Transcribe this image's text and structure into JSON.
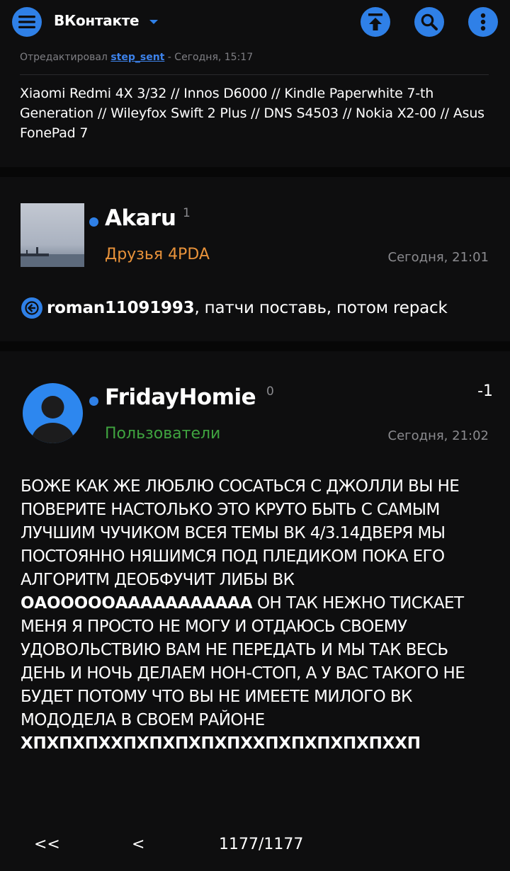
{
  "topbar": {
    "title": "ВКонтакте",
    "icons": [
      "menu-icon",
      "chevron-down-icon",
      "scroll-to-top-icon",
      "search-icon",
      "more-vertical-icon"
    ],
    "accent": "#2f80e7"
  },
  "edit_info": {
    "prefix": "Отредактировал",
    "user": "step_sent",
    "suffix": " - Сегодня, 15:17"
  },
  "signature": "Xiaomi Redmi 4X 3/32  //  Innos D6000  // Kindle Paperwhite 7-th Generation  //  Wileyfox Swift 2 Plus  //  DNS S4503  //  Nokia X2-00 //  Asus FonePad 7",
  "posts": [
    {
      "author": "Akaru",
      "reputation": "1",
      "group": "Друзья 4PDA",
      "group_color": "#e8923a",
      "time": "Сегодня, 21:01",
      "reply_to": "roman11091993",
      "text": ", патчи поставь, потом repack"
    },
    {
      "author": "FridayHomie",
      "reputation": "0",
      "group": "Пользователи",
      "group_color": "#3fa33f",
      "time": "Сегодня, 21:02",
      "rating": "-1",
      "text_part1": "БОЖЕ КАК ЖЕ ЛЮБЛЮ СОСАТЬСЯ С ДЖОЛЛИ ВЫ НЕ ПОВЕРИТЕ НАСТОЛЬКО ЭТО КРУТО БЫТЬ С САМЫМ ЛУЧШИМ ЧУЧИКОМ ВСЕЯ ТЕМЫ ВК 4/3.14ДВЕРЯ МЫ ПОСТОЯННО НЯШИМСЯ ПОД ПЛЕДИКОМ ПОКА ЕГО АЛГОРИТМ ДЕОБФУЧИТ ЛИБЫ ВК ",
      "text_bold1": "ОАОООООААААААААААА",
      "text_part2": " ОН ТАК НЕЖНО ТИСКАЕТ МЕНЯ Я ПРОСТО НЕ МОГУ И ОТДАЮСЬ СВОЕМУ УДОВОЛЬСТВИЮ ВАМ НЕ ПЕРЕДАТЬ И МЫ ТАК ВЕСЬ ДЕНЬ И НОЧЬ ДЕЛАЕМ НОН-СТОП, А У ВАС ТАКОГО НЕ БУДЕТ ПОТОМУ ЧТО ВЫ НЕ ИМЕЕТЕ МИЛОГО ВК МОДОДЕЛА В СВОЕМ РАЙОНЕ",
      "text_bold2": "ХПХПХПХХПХПХПХПХПХХПХПХПХПХПХХП"
    }
  ],
  "pager": {
    "first": "<<",
    "prev": "<",
    "current": "1177/1177"
  }
}
